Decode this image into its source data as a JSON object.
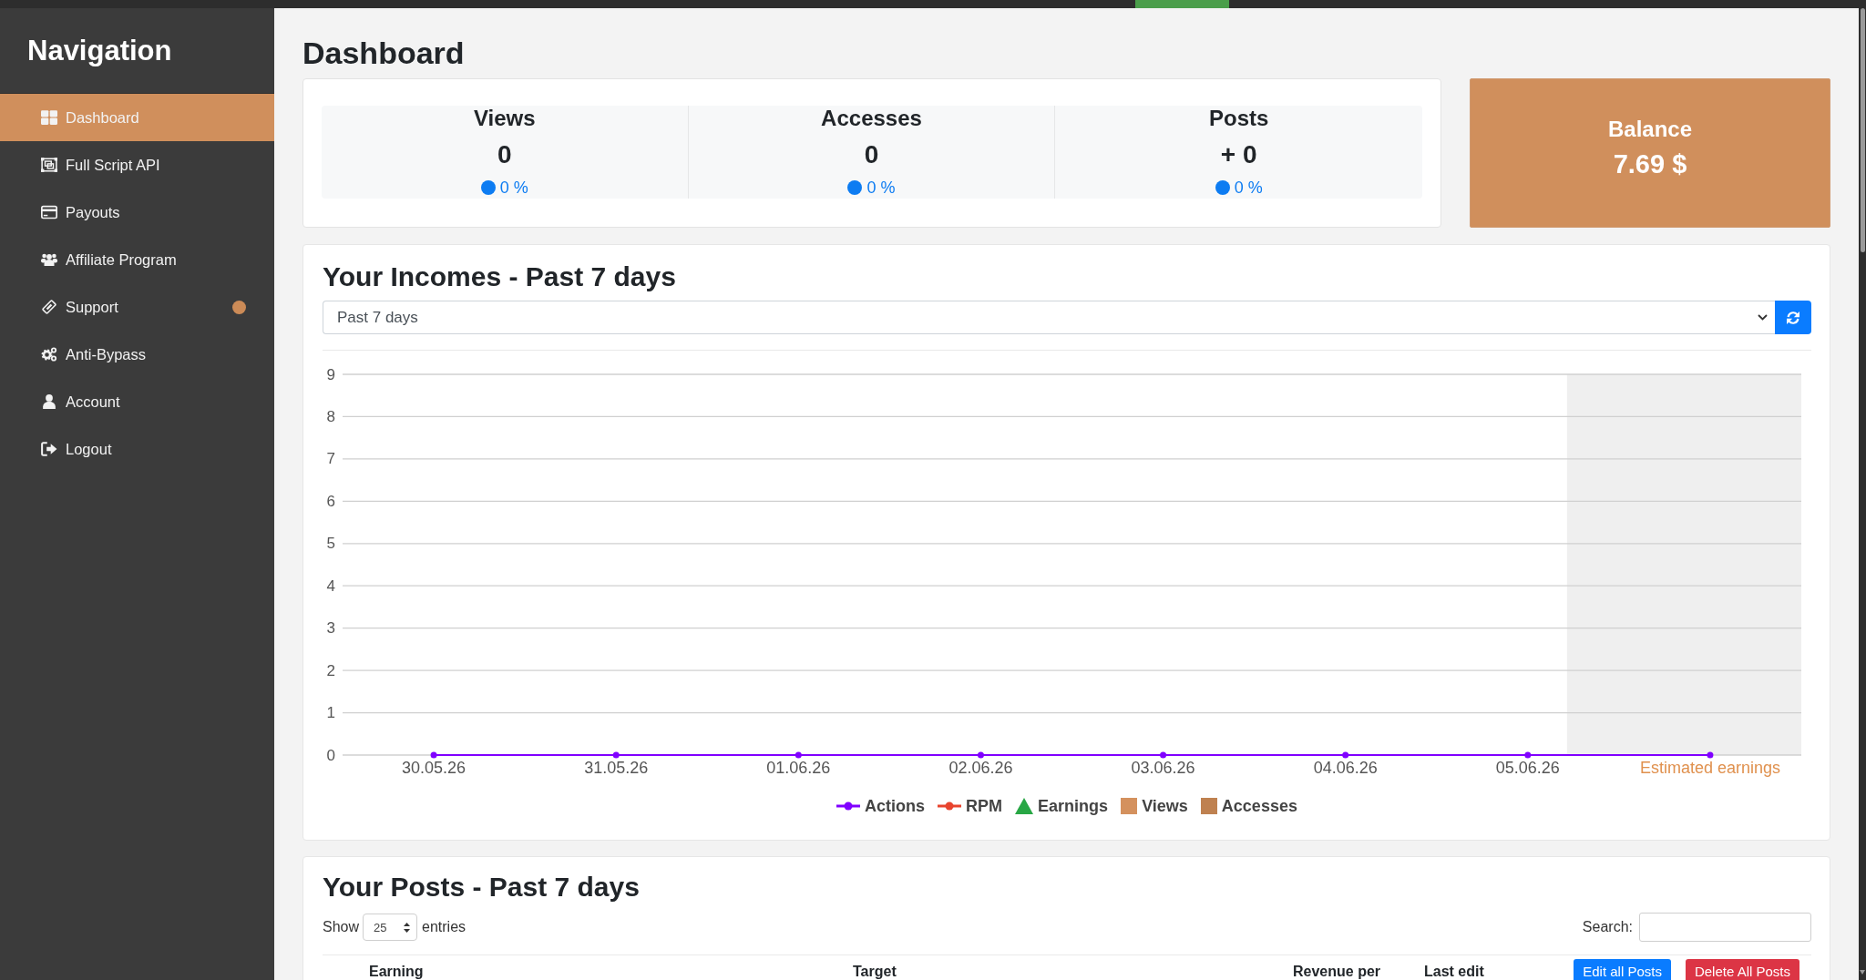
{
  "sidebar": {
    "title": "Navigation",
    "items": [
      {
        "label": "Dashboard",
        "selected": true,
        "notification": false
      },
      {
        "label": "Full Script API",
        "selected": false,
        "notification": false
      },
      {
        "label": "Payouts",
        "selected": false,
        "notification": false
      },
      {
        "label": "Affiliate Program",
        "selected": false,
        "notification": false
      },
      {
        "label": "Support",
        "selected": false,
        "notification": true
      },
      {
        "label": "Anti-Bypass",
        "selected": false,
        "notification": false
      },
      {
        "label": "Account",
        "selected": false,
        "notification": false
      },
      {
        "label": "Logout",
        "selected": false,
        "notification": false
      }
    ]
  },
  "page_title": "Dashboard",
  "stats": [
    {
      "title": "Views",
      "value": "0",
      "change": "0 %"
    },
    {
      "title": "Accesses",
      "value": "0",
      "change": "0 %"
    },
    {
      "title": "Posts",
      "value": "+ 0",
      "change": "0 %"
    }
  ],
  "balance": {
    "title": "Balance",
    "value": "7.69 $"
  },
  "incomes": {
    "title": "Your Incomes - Past 7 days",
    "period": "Past 7 days",
    "chart_data": {
      "type": "line",
      "categories": [
        "30.05.26",
        "31.05.26",
        "01.06.26",
        "02.06.26",
        "03.06.26",
        "04.06.26",
        "05.06.26",
        "Estimated earnings"
      ],
      "ylim": [
        0,
        9
      ],
      "yticks": [
        0,
        1,
        2,
        3,
        4,
        5,
        6,
        7,
        8,
        9
      ],
      "grid": true,
      "series": [
        {
          "name": "Actions",
          "color": "#8000ff",
          "marker": "o",
          "values": [
            0,
            0,
            0,
            0,
            0,
            0,
            0,
            0
          ]
        },
        {
          "name": "RPM",
          "color": "#e8442e",
          "marker": "o",
          "values": [
            null,
            null,
            null,
            null,
            null,
            null,
            null,
            null
          ]
        },
        {
          "name": "Earnings",
          "color": "#28a745",
          "marker": "^",
          "values": [
            null,
            null,
            null,
            null,
            null,
            null,
            null,
            null
          ]
        },
        {
          "name": "Views",
          "color": "#d4915e",
          "marker": "s",
          "values": [
            null,
            null,
            null,
            null,
            null,
            null,
            null,
            null
          ]
        },
        {
          "name": "Accesses",
          "color": "#bf8150",
          "marker": "s",
          "values": [
            null,
            null,
            null,
            null,
            null,
            null,
            null,
            null
          ]
        }
      ]
    }
  },
  "posts": {
    "title": "Your Posts - Past 7 days",
    "show_label": "Show",
    "page_size": "25",
    "entries_label": "entries",
    "search_label": "Search:",
    "columns": [
      "Earning",
      "Target",
      "Revenue per",
      "Last edit"
    ],
    "buttons": [
      {
        "label": "Edit all Posts",
        "kind": "primary"
      },
      {
        "label": "Delete All Posts",
        "kind": "danger"
      }
    ]
  }
}
